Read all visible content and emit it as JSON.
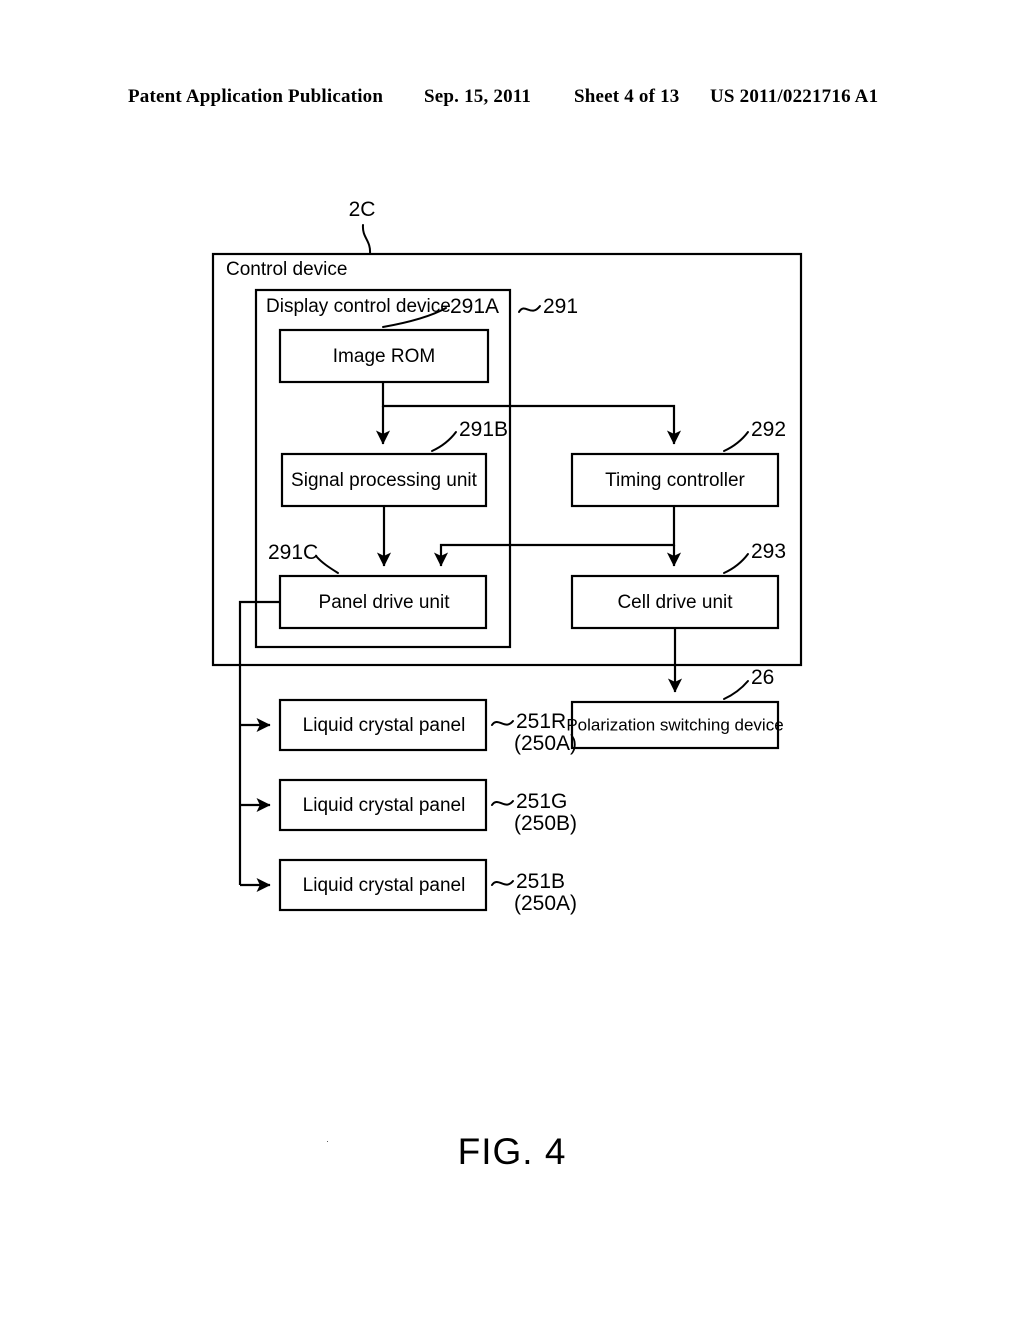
{
  "header": {
    "publication": "Patent Application Publication",
    "date": "Sep. 15, 2011",
    "sheet": "Sheet 4 of 13",
    "number": "US 2011/0221716 A1"
  },
  "figure": {
    "caption": "FIG. 4",
    "speck": "·"
  },
  "diagram": {
    "top_reference": "2C",
    "containers": [
      {
        "label": "Control device",
        "reference": "2C"
      },
      {
        "label": "Display control device",
        "reference": "291"
      }
    ],
    "blocks": [
      {
        "id": "image_rom",
        "label": "Image ROM",
        "reference": "291A"
      },
      {
        "id": "signal_proc",
        "label": "Signal processing unit",
        "reference": "291B"
      },
      {
        "id": "timing_ctrl",
        "label": "Timing controller",
        "reference": "292"
      },
      {
        "id": "panel_drive",
        "label": "Panel drive unit",
        "reference": "291C"
      },
      {
        "id": "cell_drive",
        "label": "Cell drive unit",
        "reference": "293"
      },
      {
        "id": "lcd_r",
        "label": "Liquid crystal panel",
        "reference": "251R",
        "reference2": "(250A)"
      },
      {
        "id": "lcd_g",
        "label": "Liquid crystal panel",
        "reference": "251G",
        "reference2": "(250B)"
      },
      {
        "id": "lcd_b",
        "label": "Liquid crystal panel",
        "reference": "251B",
        "reference2": "(250A)"
      },
      {
        "id": "polar_switch",
        "label": "Polarization switching device",
        "reference": "26"
      }
    ],
    "connections": [
      {
        "from": "image_rom",
        "to": "signal_proc"
      },
      {
        "from": "image_rom",
        "to": "timing_ctrl"
      },
      {
        "from": "signal_proc",
        "to": "panel_drive"
      },
      {
        "from": "timing_ctrl",
        "to": "panel_drive"
      },
      {
        "from": "timing_ctrl",
        "to": "cell_drive"
      },
      {
        "from": "cell_drive",
        "to": "polar_switch"
      },
      {
        "from": "panel_drive",
        "to": "lcd_r"
      },
      {
        "from": "panel_drive",
        "to": "lcd_g"
      },
      {
        "from": "panel_drive",
        "to": "lcd_b"
      }
    ]
  }
}
